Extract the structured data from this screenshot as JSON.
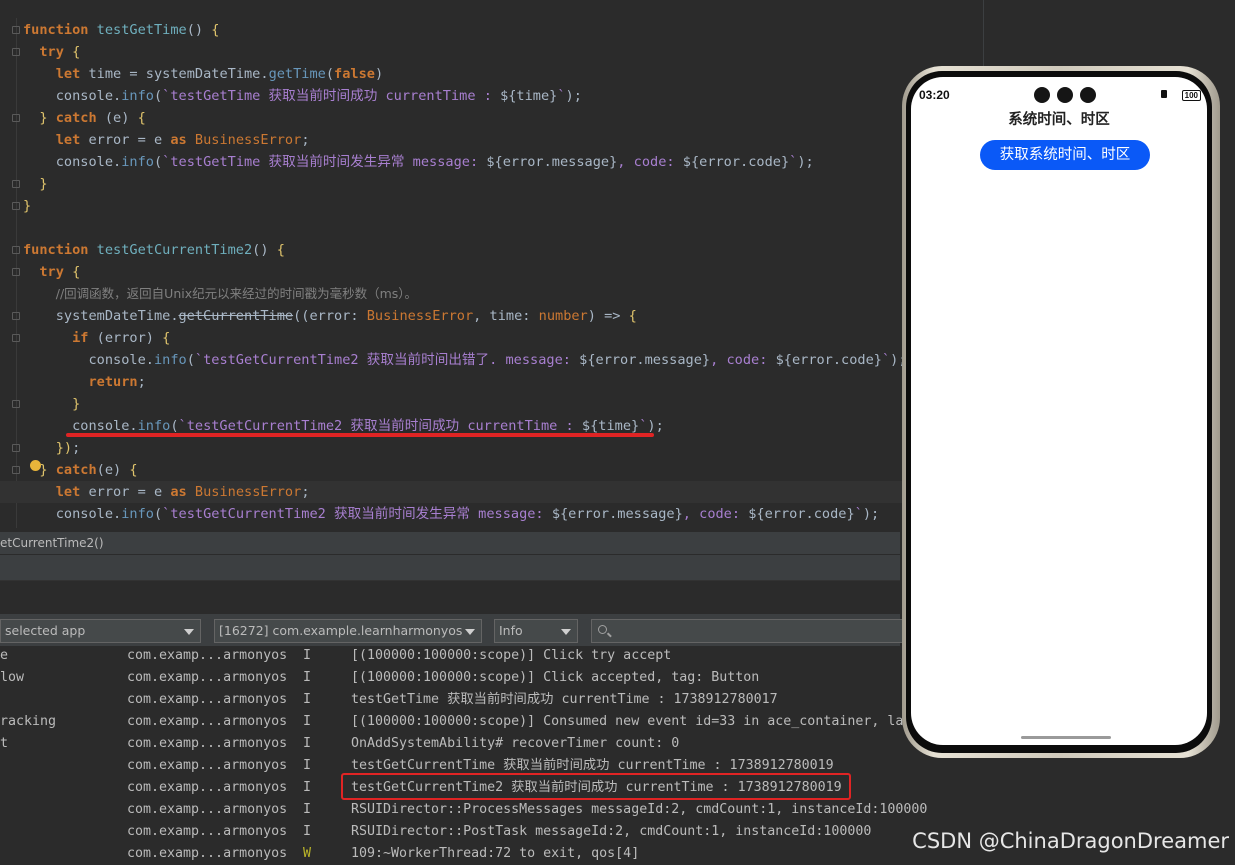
{
  "editor": {
    "lines": [
      {
        "tokens": [
          [
            "kw",
            "function "
          ],
          [
            "fn",
            "testGetTime"
          ],
          [
            "p",
            "() "
          ],
          [
            "brk",
            "{"
          ]
        ]
      },
      {
        "tokens": [
          [
            "p",
            "  "
          ],
          [
            "kw",
            "try "
          ],
          [
            "brk",
            "{"
          ]
        ]
      },
      {
        "tokens": [
          [
            "p",
            "    "
          ],
          [
            "kw",
            "let "
          ],
          [
            "p",
            "time = systemDateTime."
          ],
          [
            "meth",
            "getTime"
          ],
          [
            "p",
            "("
          ],
          [
            "kw",
            "false"
          ],
          [
            "p",
            ")"
          ]
        ]
      },
      {
        "tokens": [
          [
            "p",
            "    console."
          ],
          [
            "meth",
            "info"
          ],
          [
            "p",
            "("
          ],
          [
            "str",
            "`testGetTime 获取当前时间成功 currentTime : "
          ],
          [
            "p",
            "${time}"
          ],
          [
            "str",
            "`"
          ],
          [
            "p",
            ");"
          ]
        ]
      },
      {
        "tokens": [
          [
            "p",
            "  "
          ],
          [
            "brk",
            "} "
          ],
          [
            "kw",
            "catch "
          ],
          [
            "p",
            "(e) "
          ],
          [
            "brk",
            "{"
          ]
        ]
      },
      {
        "tokens": [
          [
            "p",
            "    "
          ],
          [
            "kw",
            "let "
          ],
          [
            "p",
            "error = e "
          ],
          [
            "kw",
            "as "
          ],
          [
            "typ",
            "BusinessError"
          ],
          [
            "p",
            ";"
          ]
        ]
      },
      {
        "tokens": [
          [
            "p",
            "    console."
          ],
          [
            "meth",
            "info"
          ],
          [
            "p",
            "("
          ],
          [
            "str",
            "`testGetTime 获取当前时间发生异常 message: "
          ],
          [
            "p",
            "${error.message}"
          ],
          [
            "str",
            ", code: "
          ],
          [
            "p",
            "${error.code}"
          ],
          [
            "str",
            "`"
          ],
          [
            "p",
            ");"
          ]
        ]
      },
      {
        "tokens": [
          [
            "p",
            "  "
          ],
          [
            "brk",
            "}"
          ]
        ]
      },
      {
        "tokens": [
          [
            "brk",
            "}"
          ]
        ]
      },
      {
        "tokens": []
      },
      {
        "tokens": [
          [
            "kw",
            "function "
          ],
          [
            "fn",
            "testGetCurrentTime2"
          ],
          [
            "p",
            "() "
          ],
          [
            "brk",
            "{"
          ]
        ]
      },
      {
        "tokens": [
          [
            "p",
            "  "
          ],
          [
            "kw",
            "try "
          ],
          [
            "brk",
            "{"
          ]
        ]
      },
      {
        "tokens": [
          [
            "p",
            "    "
          ],
          [
            "cmt",
            "//回调函数，返回自Unix纪元以来经过的时间戳为毫秒数（ms）。"
          ]
        ]
      },
      {
        "tokens": [
          [
            "p",
            "    systemDateTime."
          ],
          [
            "strike",
            "getCurrentTime"
          ],
          [
            "p",
            "((error: "
          ],
          [
            "typ",
            "BusinessError"
          ],
          [
            "p",
            ", time: "
          ],
          [
            "typ",
            "number"
          ],
          [
            "p",
            ") => "
          ],
          [
            "brk",
            "{"
          ]
        ]
      },
      {
        "tokens": [
          [
            "p",
            "      "
          ],
          [
            "kw",
            "if "
          ],
          [
            "p",
            "(error) "
          ],
          [
            "brk",
            "{"
          ]
        ]
      },
      {
        "tokens": [
          [
            "p",
            "        console."
          ],
          [
            "meth",
            "info"
          ],
          [
            "p",
            "("
          ],
          [
            "str",
            "`testGetCurrentTime2 获取当前时间出错了. message: "
          ],
          [
            "p",
            "${error.message}"
          ],
          [
            "str",
            ", code: "
          ],
          [
            "p",
            "${error.code}"
          ],
          [
            "str",
            "`"
          ],
          [
            "p",
            ");"
          ]
        ]
      },
      {
        "tokens": [
          [
            "p",
            "        "
          ],
          [
            "kw",
            "return"
          ],
          [
            "p",
            ";"
          ]
        ]
      },
      {
        "tokens": [
          [
            "p",
            "      "
          ],
          [
            "brk",
            "}"
          ]
        ]
      },
      {
        "tokens": [
          [
            "p",
            "      console."
          ],
          [
            "meth",
            "info"
          ],
          [
            "p",
            "("
          ],
          [
            "str",
            "`testGetCurrentTime2 获取当前时间成功 currentTime : "
          ],
          [
            "p",
            "${time}"
          ],
          [
            "str",
            "`"
          ],
          [
            "p",
            ");"
          ]
        ]
      },
      {
        "tokens": [
          [
            "p",
            "    "
          ],
          [
            "brk",
            "})"
          ],
          [
            "p",
            ";"
          ]
        ]
      },
      {
        "tokens": [
          [
            "p",
            "  "
          ],
          [
            "brk",
            "} "
          ],
          [
            "kw",
            "catch"
          ],
          [
            "p",
            "(e) "
          ],
          [
            "brk",
            "{"
          ]
        ]
      },
      {
        "tokens": [
          [
            "p",
            "    "
          ],
          [
            "kw",
            "let "
          ],
          [
            "p",
            "error = e "
          ],
          [
            "kw",
            "as "
          ],
          [
            "typ",
            "BusinessError"
          ],
          [
            "p",
            ";"
          ]
        ]
      },
      {
        "tokens": [
          [
            "p",
            "    console."
          ],
          [
            "meth",
            "info"
          ],
          [
            "p",
            "("
          ],
          [
            "str",
            "`testGetCurrentTime2 获取当前时间发生异常 message: "
          ],
          [
            "p",
            "${error.message}"
          ],
          [
            "str",
            ", code: "
          ],
          [
            "p",
            "${error.code}"
          ],
          [
            "str",
            "`"
          ],
          [
            "p",
            ");"
          ]
        ]
      }
    ]
  },
  "breadcrumb": {
    "text": "etCurrentTime2()"
  },
  "filters": {
    "app": "selected app",
    "process": "[16272] com.example.learnharmonyos",
    "level": "Info",
    "search_placeholder": ""
  },
  "log": {
    "rows": [
      {
        "tag": "e",
        "pkg": "com.examp...armonyos",
        "level": "I",
        "msg": "[(100000:100000:scope)] Click try accept"
      },
      {
        "tag": "low",
        "pkg": "com.examp...armonyos",
        "level": "I",
        "msg": "[(100000:100000:scope)] Click accepted, tag: Button"
      },
      {
        "tag": "",
        "pkg": "com.examp...armonyos",
        "level": "I",
        "msg": "testGetTime 获取当前时间成功 currentTime : 1738912780017"
      },
      {
        "tag": "racking",
        "pkg": "com.examp...armonyos",
        "level": "I",
        "msg": "[(100000:100000:scope)] Consumed new event id=33 in ace_container, la"
      },
      {
        "tag": "t",
        "pkg": "com.examp...armonyos",
        "level": "I",
        "msg": "OnAddSystemAbility# recoverTimer count: 0"
      },
      {
        "tag": "",
        "pkg": "com.examp...armonyos",
        "level": "I",
        "msg": "testGetCurrentTime 获取当前时间成功 currentTime : 1738912780019"
      },
      {
        "tag": "",
        "pkg": "com.examp...armonyos",
        "level": "I",
        "msg": "testGetCurrentTime2 获取当前时间成功 currentTime : 1738912780019"
      },
      {
        "tag": "",
        "pkg": "com.examp...armonyos",
        "level": "I",
        "msg": "RSUIDirector::ProcessMessages messageId:2, cmdCount:1, instanceId:100000"
      },
      {
        "tag": "",
        "pkg": "com.examp...armonyos",
        "level": "I",
        "msg": "RSUIDirector::PostTask messageId:2, cmdCount:1, instanceId:100000"
      },
      {
        "tag": "",
        "pkg": "com.examp...armonyos",
        "level": "W",
        "msg": "109:~WorkerThread:72 to exit, qos[4]"
      }
    ]
  },
  "phone": {
    "status_time": "03:20",
    "battery": "100",
    "title": "系统时间、时区",
    "button_label": "获取系统时间、时区"
  },
  "watermark": "CSDN @ChinaDragonDreamer"
}
